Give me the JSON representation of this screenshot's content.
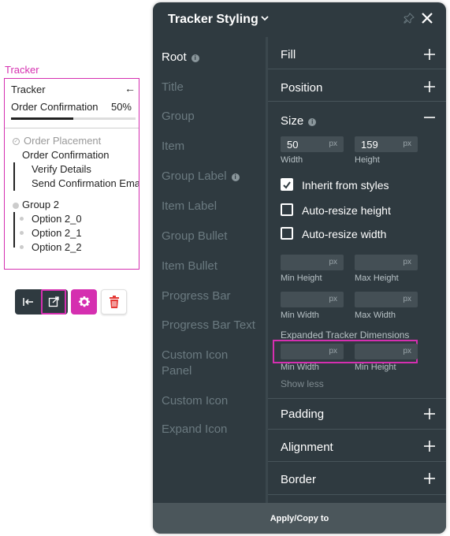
{
  "tracker_preview": {
    "tag": "Tracker",
    "header": "Tracker",
    "status": "Order Confirmation",
    "percent": "50%",
    "progress": 0.5,
    "items": [
      {
        "label": "Order Placement",
        "muted": true
      },
      {
        "label": "Order Confirmation",
        "muted": false
      },
      {
        "label": "Verify Details",
        "muted": false
      },
      {
        "label": "Send Confirmation Email",
        "muted": false
      },
      {
        "label": "Group 2",
        "muted": false
      },
      {
        "label": "Option 2_0",
        "muted": false
      },
      {
        "label": "Option 2_1",
        "muted": false
      },
      {
        "label": "Option 2_2",
        "muted": false
      }
    ]
  },
  "toolbar": {
    "icons": [
      "collapse-left-icon",
      "open-external-icon",
      "gear-icon",
      "trash-icon"
    ],
    "accent": "#d52fb0"
  },
  "panel": {
    "title": "Tracker Styling",
    "footer": "Apply/Copy to",
    "nav": [
      {
        "label": "Root",
        "active": true,
        "info": true
      },
      {
        "label": "Title",
        "active": false
      },
      {
        "label": "Group",
        "active": false
      },
      {
        "label": "Item",
        "active": false
      },
      {
        "label": "Group Label",
        "active": false,
        "info": true
      },
      {
        "label": "Item Label",
        "active": false
      },
      {
        "label": "Group Bullet",
        "active": false
      },
      {
        "label": "Item Bullet",
        "active": false
      },
      {
        "label": "Progress Bar",
        "active": false
      },
      {
        "label": "Progress Bar Text",
        "active": false
      },
      {
        "label": "Custom Icon Panel",
        "active": false
      },
      {
        "label": "Custom Icon",
        "active": false
      },
      {
        "label": "Expand Icon",
        "active": false
      }
    ],
    "sections": {
      "fill": "Fill",
      "position": "Position",
      "size": "Size",
      "padding": "Padding",
      "alignment": "Alignment",
      "border": "Border"
    },
    "size": {
      "width_value": "50",
      "height_value": "159",
      "unit": "px",
      "width_label": "Width",
      "height_label": "Height",
      "inherit_label": "Inherit from styles",
      "inherit_checked": true,
      "auto_height_label": "Auto-resize height",
      "auto_height_checked": false,
      "auto_width_label": "Auto-resize width",
      "auto_width_checked": false,
      "min_height_label": "Min Height",
      "max_height_label": "Max Height",
      "min_width_label": "Min Width",
      "max_width_label": "Max Width",
      "expanded_title": "Expanded Tracker Dimensions",
      "exp_min_width_label": "Min Width",
      "exp_min_height_label": "Min Height",
      "show_less": "Show less"
    },
    "colors": {
      "panel_bg": "#2f3a40",
      "field_bg": "#444f55",
      "highlight": "#d52fb0"
    }
  }
}
